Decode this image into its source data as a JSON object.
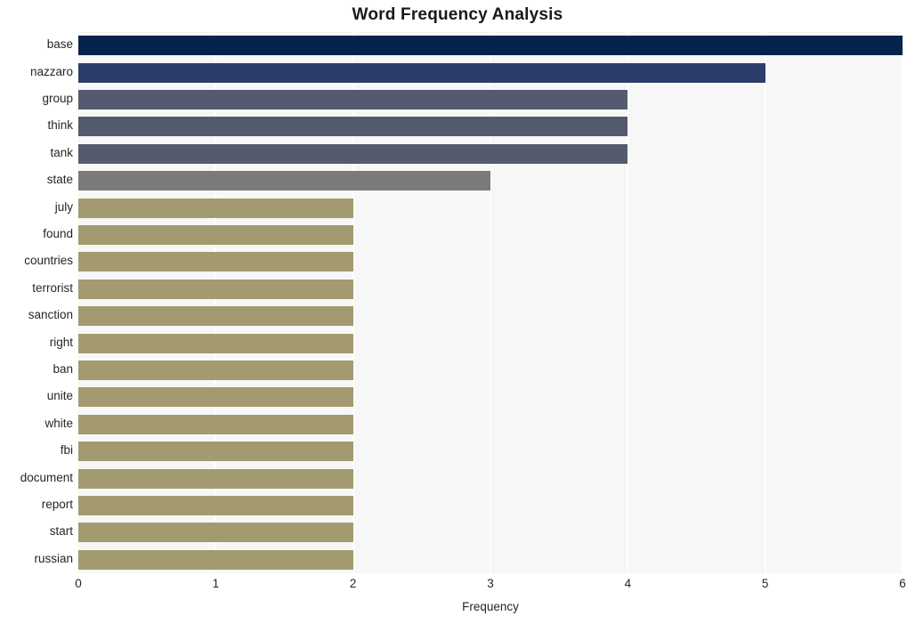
{
  "chart_data": {
    "type": "bar",
    "orientation": "horizontal",
    "title": "Word Frequency Analysis",
    "xlabel": "Frequency",
    "ylabel": "",
    "xlim": [
      0,
      6
    ],
    "xticks": [
      "0",
      "1",
      "2",
      "3",
      "4",
      "5",
      "6"
    ],
    "grid": "vertical",
    "legend": "none",
    "categories": [
      "base",
      "nazzaro",
      "group",
      "think",
      "tank",
      "state",
      "july",
      "found",
      "countries",
      "terrorist",
      "sanction",
      "right",
      "ban",
      "unite",
      "white",
      "fbi",
      "document",
      "report",
      "start",
      "russian"
    ],
    "values": [
      6,
      5,
      4,
      4,
      4,
      3,
      2,
      2,
      2,
      2,
      2,
      2,
      2,
      2,
      2,
      2,
      2,
      2,
      2,
      2
    ],
    "bar_colors": [
      "#06234c",
      "#2b3d6b",
      "#555b6e",
      "#545a6d",
      "#545b6e",
      "#7b7a78",
      "#a49a70",
      "#a49a70",
      "#a49a70",
      "#a49a70",
      "#a49a70",
      "#a49a70",
      "#a49a70",
      "#a49a70",
      "#a49a70",
      "#a49a70",
      "#a49a70",
      "#a49a70",
      "#a49a70",
      "#a49a70"
    ],
    "plot_background": "#f7f7f8",
    "figure_background": "#ffffff",
    "gridline_color": "#ffffff",
    "text_color": "#262626",
    "title_color": "#1a1a1a"
  }
}
